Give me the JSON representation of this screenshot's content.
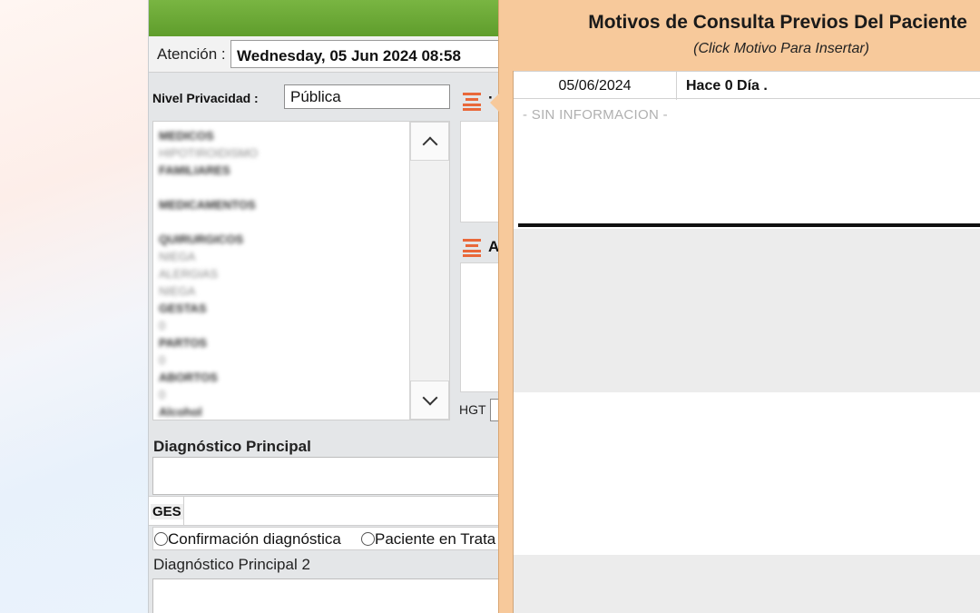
{
  "colors": {
    "header_green": "#6aa734",
    "modal_bg": "#f7c99b",
    "accent_orange": "#e9683a"
  },
  "form": {
    "atencion_label": "Atención :",
    "atencion_value": "Wednesday, 05 Jun 2024 08:58",
    "privacy_label": "Nivel Privacidad :",
    "privacy_value": "Pública",
    "section_letter": "A",
    "hgt_label": "HGT",
    "diagnosis_title": "Diagnóstico Principal",
    "ges_label": "GES",
    "radio_options": [
      "Confirmación diagnóstica",
      "Paciente en Trata"
    ],
    "diagnosis2_title": "Diagnóstico Principal 2"
  },
  "history": {
    "items": [
      {
        "text": "MEDICOS",
        "kind": "h"
      },
      {
        "text": "HIPOTIROIDISMO",
        "kind": "v"
      },
      {
        "text": "FAMILIARES",
        "kind": "h"
      },
      {
        "text": "",
        "kind": "gap"
      },
      {
        "text": "MEDICAMENTOS",
        "kind": "h"
      },
      {
        "text": "",
        "kind": "gap"
      },
      {
        "text": "QUIRURGICOS",
        "kind": "h"
      },
      {
        "text": "NIEGA",
        "kind": "v"
      },
      {
        "text": "ALERGIAS",
        "kind": "v"
      },
      {
        "text": "NIEGA",
        "kind": "v"
      },
      {
        "text": "GESTAS",
        "kind": "h"
      },
      {
        "text": "0",
        "kind": "v"
      },
      {
        "text": "PARTOS",
        "kind": "h"
      },
      {
        "text": "0",
        "kind": "v"
      },
      {
        "text": "ABORTOS",
        "kind": "h"
      },
      {
        "text": "0",
        "kind": "v"
      },
      {
        "text": "Alcohol",
        "kind": "h"
      }
    ]
  },
  "modal": {
    "title": "Motivos de Consulta Previos Del Paciente",
    "subtitle": "(Click Motivo Para Insertar)",
    "record_date": "05/06/2024",
    "record_ago": "Hace 0 Día .",
    "no_info": "- SIN INFORMACION -"
  }
}
